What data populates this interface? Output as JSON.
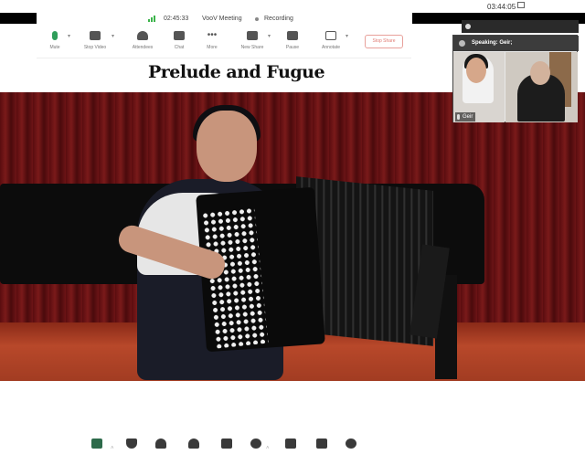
{
  "system": {
    "clock": "03:44:05"
  },
  "status": {
    "elapsed": "02:45:33",
    "app_name": "VooV Meeting",
    "recording_label": "Recording"
  },
  "toolbar": {
    "mute": "Mute",
    "stop_video": "Stop Video",
    "attendees": "Attendees",
    "chat": "Chat",
    "more": "More",
    "new_share": "New Share",
    "pause": "Pause",
    "annotate": "Annotate",
    "stop_share": "Stop Share"
  },
  "shared_content": {
    "title": "Prelude and Fugue"
  },
  "speaker": {
    "active_label": "Speaking: Geir;",
    "participant_name": "Geir"
  },
  "bottom_toolbar": {
    "items": [
      {
        "icon": "share-screen-icon",
        "label": ""
      },
      {
        "icon": "shield-icon",
        "label": ""
      },
      {
        "icon": "invite-icon",
        "label": ""
      },
      {
        "icon": "participants-icon",
        "label": ""
      },
      {
        "icon": "chat-icon",
        "label": ""
      },
      {
        "icon": "record-icon",
        "label": ""
      },
      {
        "icon": "apps-icon",
        "label": ""
      },
      {
        "icon": "grid-icon",
        "label": ""
      },
      {
        "icon": "settings-icon",
        "label": ""
      }
    ]
  },
  "colors": {
    "accent_red": "#e07b73",
    "signal_green": "#3bb34a",
    "curtain": "#6d1416"
  }
}
